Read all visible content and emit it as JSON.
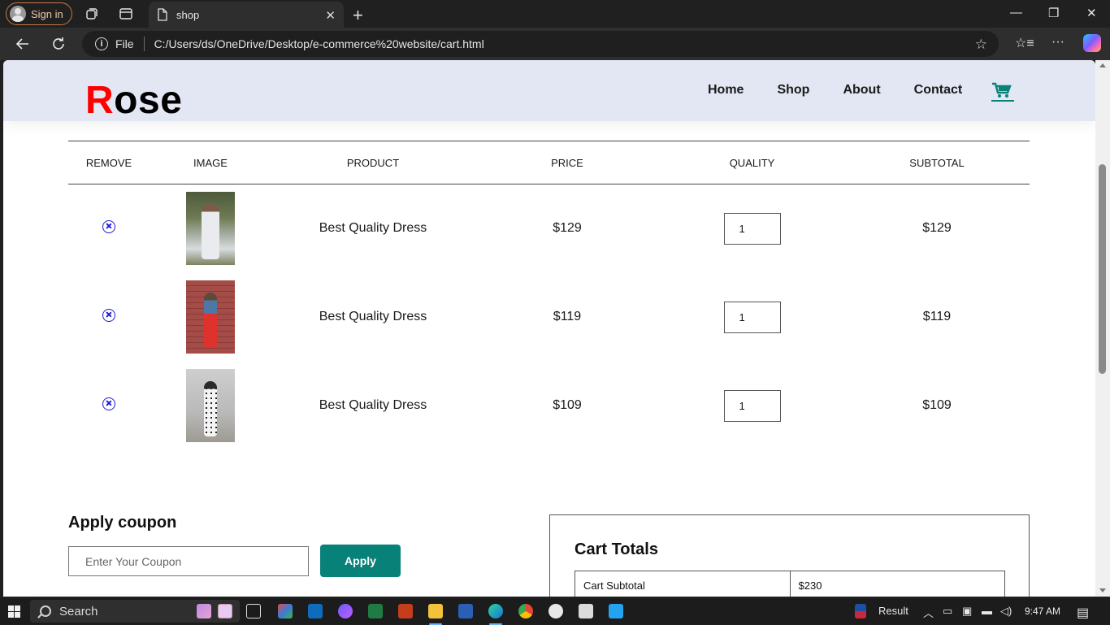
{
  "browser": {
    "signin_label": "Sign in",
    "tab_title": "shop",
    "address_scheme": "File",
    "address_url": "C:/Users/ds/OneDrive/Desktop/e-commerce%20website/cart.html"
  },
  "site": {
    "logo_first": "R",
    "logo_rest": "ose",
    "nav": [
      "Home",
      "Shop",
      "About",
      "Contact"
    ],
    "accent": "#088178",
    "logo_accent": "#ff0000"
  },
  "cart": {
    "headers": [
      "REMOVE",
      "IMAGE",
      "PRODUCT",
      "PRICE",
      "QUALITY",
      "SUBTOTAL"
    ],
    "rows": [
      {
        "product": "Best Quality Dress",
        "price": "$129",
        "qty": "1",
        "subtotal": "$129"
      },
      {
        "product": "Best Quality Dress",
        "price": "$119",
        "qty": "1",
        "subtotal": "$119"
      },
      {
        "product": "Best Quality Dress",
        "price": "$109",
        "qty": "1",
        "subtotal": "$109"
      }
    ]
  },
  "coupon": {
    "title": "Apply coupon",
    "placeholder": "Enter Your Coupon",
    "button": "Apply"
  },
  "totals": {
    "title": "Cart Totals",
    "subtotal_label": "Cart Subtotal",
    "subtotal_value": "$230"
  },
  "taskbar": {
    "search_label": "Search",
    "weather_label": "Result",
    "time": "9:47 AM"
  }
}
